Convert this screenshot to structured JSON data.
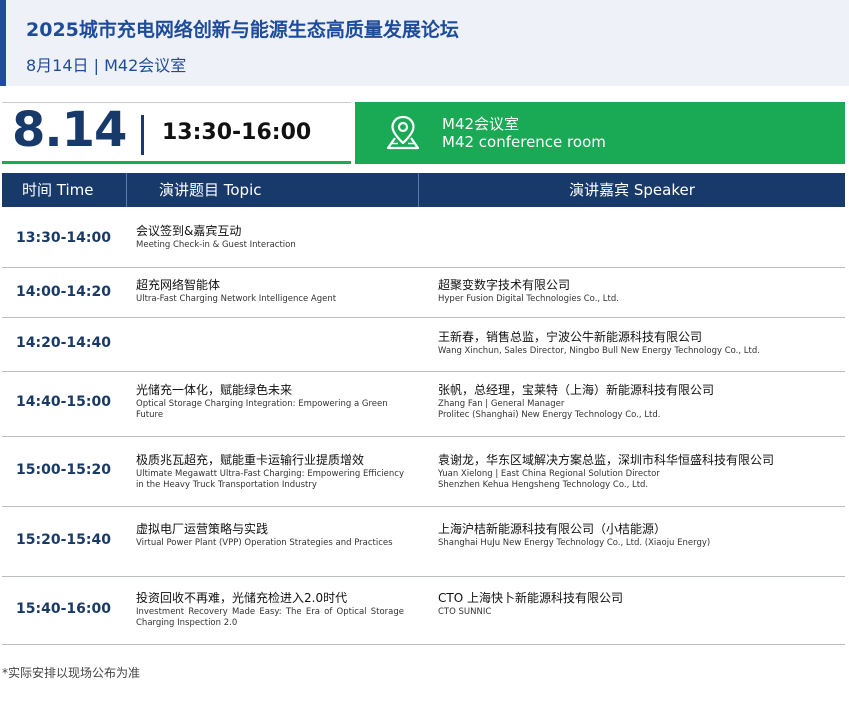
{
  "header": {
    "title": "2025城市充电网络创新与能源生态高质量发展论坛",
    "subtitle": "8月14日 | M42会议室"
  },
  "banner": {
    "date": "8.14",
    "time_range": "13:30-16:00",
    "room_cn": "M42会议室",
    "room_en": "M42 conference room",
    "icon": "location-pin-map-icon"
  },
  "colors": {
    "brand_navy": "#173a6b",
    "header_blue": "#1f4c9a",
    "accent_green": "#1aaa55",
    "header_bg": "#eef2f8"
  },
  "table": {
    "headers": {
      "time": "时间 Time",
      "topic": "演讲题目 Topic",
      "speaker": "演讲嘉宾 Speaker"
    },
    "rows": [
      {
        "time": "13:30-14:00",
        "topic_cn": "会议签到&嘉宾互动",
        "topic_en": "Meeting Check-in & Guest Interaction",
        "speaker_cn": "",
        "speaker_en": ""
      },
      {
        "time": "14:00-14:20",
        "topic_cn": "超充网络智能体",
        "topic_en": "Ultra-Fast Charging Network Intelligence Agent",
        "speaker_cn": "超聚变数字技术有限公司",
        "speaker_en": "Hyper Fusion Digital Technologies Co., Ltd."
      },
      {
        "time": "14:20-14:40",
        "topic_cn": "",
        "topic_en": "",
        "speaker_cn": "王新春，销售总监，宁波公牛新能源科技有限公司",
        "speaker_en": "Wang Xinchun, Sales Director, Ningbo Bull New Energy Technology Co., Ltd."
      },
      {
        "time": "14:40-15:00",
        "topic_cn": "光储充一体化，赋能绿色未来",
        "topic_en": "Optical Storage Charging Integration: Empowering a Green Future",
        "speaker_cn": "张帆，总经理，宝莱特（上海）新能源科技有限公司",
        "speaker_en": "Zhang Fan | General Manager",
        "speaker_en2": "Prolitec (Shanghai) New Energy Technology Co., Ltd."
      },
      {
        "time": "15:00-15:20",
        "topic_cn": "极质兆瓦超充，赋能重卡运输行业提质增效",
        "topic_en": "Ultimate Megawatt Ultra-Fast Charging: Empowering Efficiency in the Heavy Truck Transportation Industry",
        "speaker_cn": "袁谢龙，华东区域解决方案总监，深圳市科华恒盛科技有限公司",
        "speaker_en": "Yuan Xielong | East China Regional Solution Director",
        "speaker_en2": "Shenzhen Kehua Hengsheng Technology Co., Ltd."
      },
      {
        "time": "15:20-15:40",
        "topic_cn": "虚拟电厂运营策略与实践",
        "topic_en": "Virtual Power Plant (VPP) Operation Strategies and Practices",
        "speaker_cn": "上海沪桔新能源科技有限公司（小桔能源）",
        "speaker_en": "Shanghai HuJu New Energy Technology Co., Ltd. (Xiaoju Energy)"
      },
      {
        "time": "15:40-16:00",
        "topic_cn": "投资回收不再难，光储充检进入2.0时代",
        "topic_en": "Investment Recovery Made Easy: The Era of Optical Storage Charging Inspection 2.0",
        "speaker_cn": "CTO  上海快卜新能源科技有限公司",
        "speaker_en": "CTO  SUNNIC"
      }
    ]
  },
  "footnote": "*实际安排以现场公布为准"
}
